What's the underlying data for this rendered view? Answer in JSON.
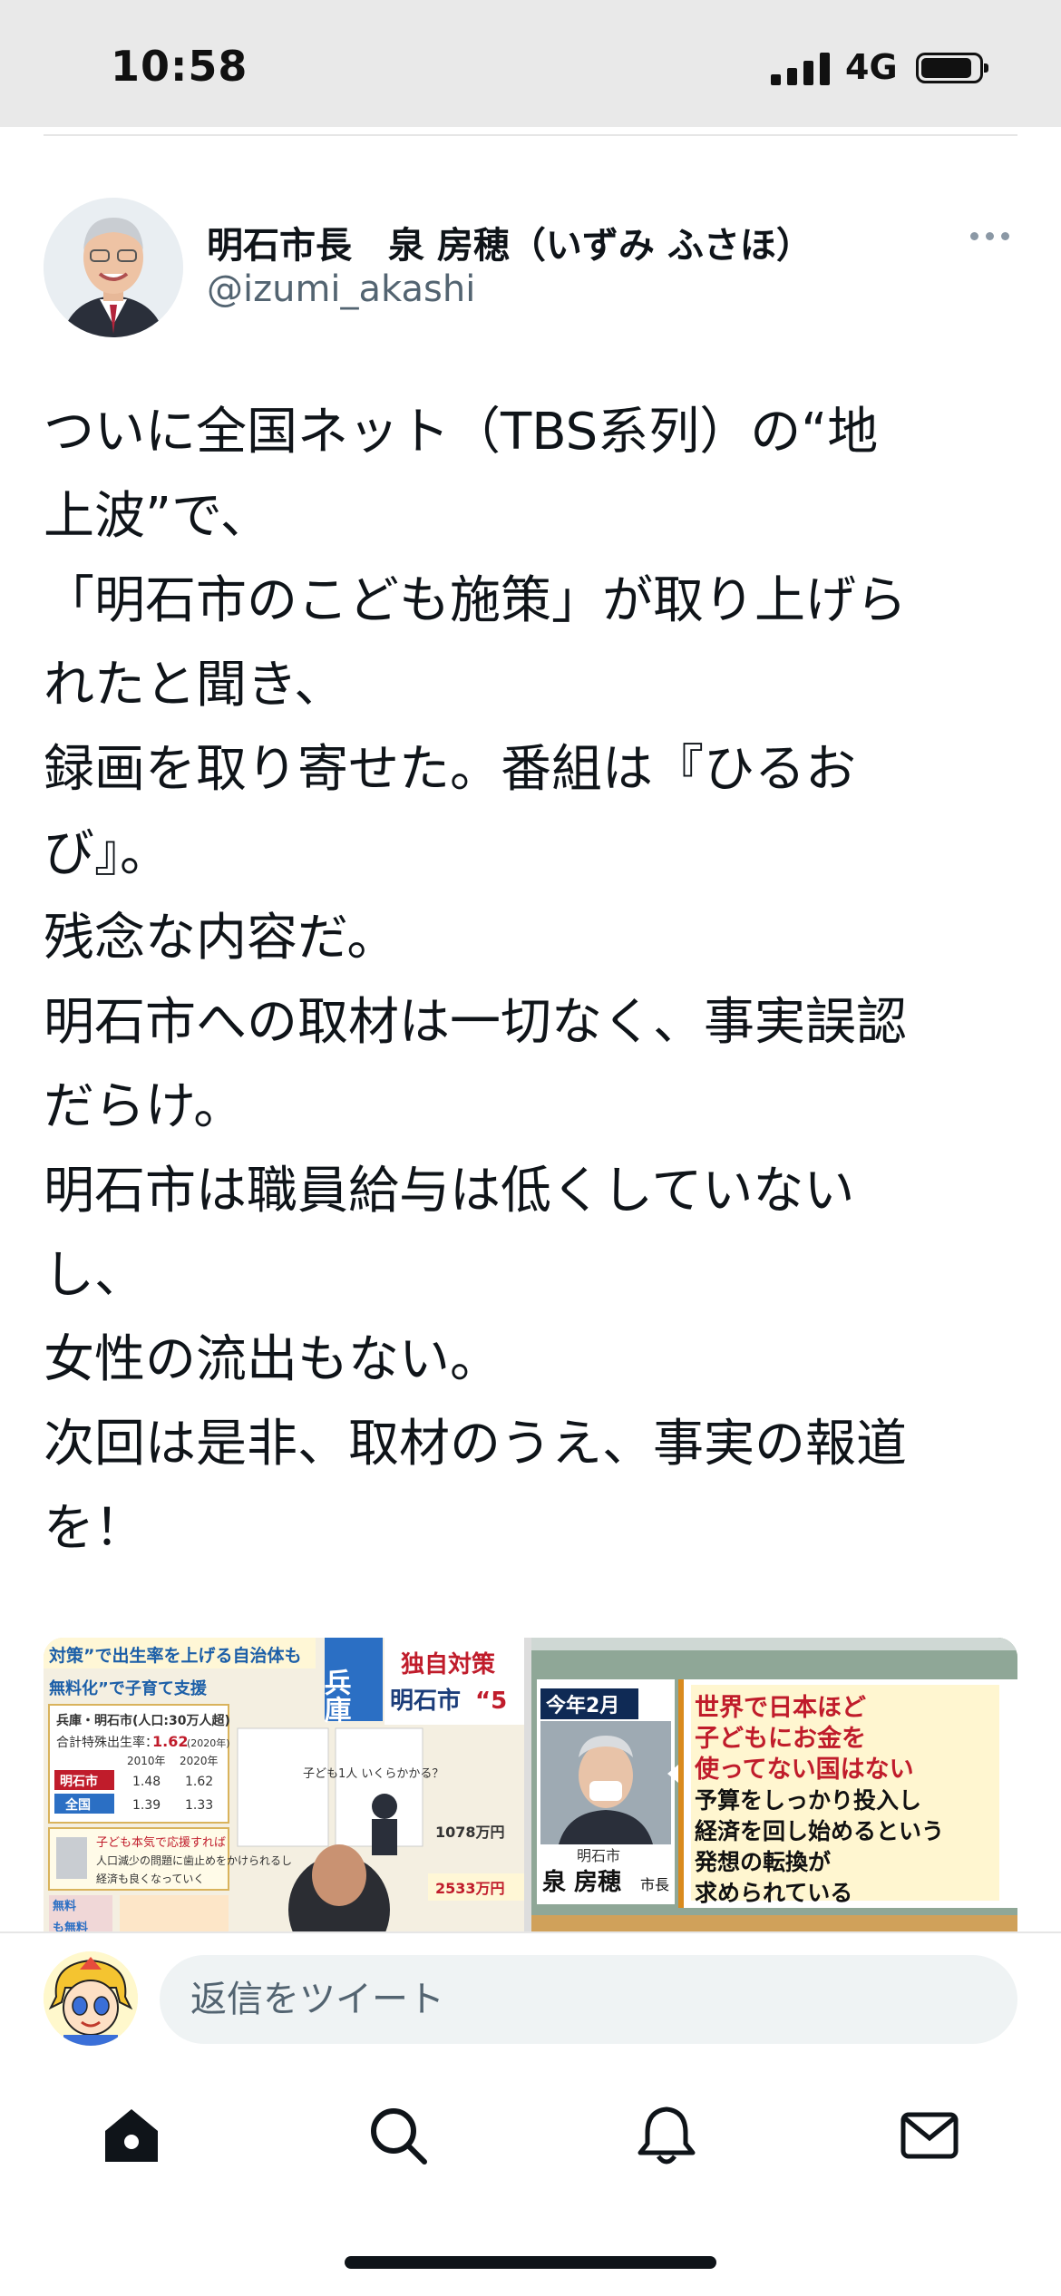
{
  "status_bar": {
    "time": "10:58",
    "network": "4G"
  },
  "tweet": {
    "author_name": "明石市長　泉 房穂（いずみ ふさほ）",
    "author_handle": "@izumi_akashi",
    "body_lines": [
      "ついに全国ネット（TBS系列）の“地",
      "上波”で、",
      "「明石市のこども施策」が取り上げら",
      "れたと聞き、",
      "録画を取り寄せた。番組は『ひるお",
      "び』。",
      "残念な内容だ。",
      "明石市への取材は一切なく、事実誤認",
      "だらけ。",
      "明石市は職員給与は低くしていない",
      "し、",
      "女性の流出もない。",
      "次回は是非、取材のうえ、事実の報道",
      "を！"
    ]
  },
  "media": {
    "left": {
      "header_small": "対策”で出生率を上げる自治体も",
      "header_small2": "無料化”で子育て支援",
      "badge": "兵庫",
      "title1": "独自対策",
      "title2": "明石市",
      "title2_suffix": "“5",
      "table_title": "兵庫・明石市(人口:30万人超)",
      "rate_label": "合計特殊出生率：",
      "rate_value": "1.62",
      "rate_year": "(2020年)",
      "year1": "2010年",
      "year2": "2020年",
      "row1_label": "明石市",
      "row1_v1": "1.48",
      "row1_v2": "1.62",
      "row2_label": "全国",
      "row2_v1": "1.39",
      "row2_v2": "1.33",
      "note1": "子ども本気で応援すれば",
      "note2": "人口減少の問題に歯止めをかけられるし",
      "note3": "経済も良くなっていく",
      "cost_q": "子ども1人 いくらかかる？",
      "cost1": "1078万円",
      "cost2": "2533万円",
      "free1": "無料",
      "free2": "も無料"
    },
    "right": {
      "date_label": "今年2月",
      "caption_city": "明石市",
      "caption_name": "泉 房穂",
      "caption_title": "市長",
      "quote_red1": "世界で日本ほど",
      "quote_red2": "子どもにお金を",
      "quote_red3": "使ってない国はない",
      "quote_black1": "予算をしっかり投入し",
      "quote_black2": "経済を回し始めるという",
      "quote_black3": "発想の転換が",
      "quote_black4": "求められている"
    }
  },
  "reply": {
    "placeholder": "返信をツイート"
  },
  "icons": [
    "more-icon",
    "home-icon",
    "search-icon",
    "notifications-icon",
    "messages-icon"
  ]
}
